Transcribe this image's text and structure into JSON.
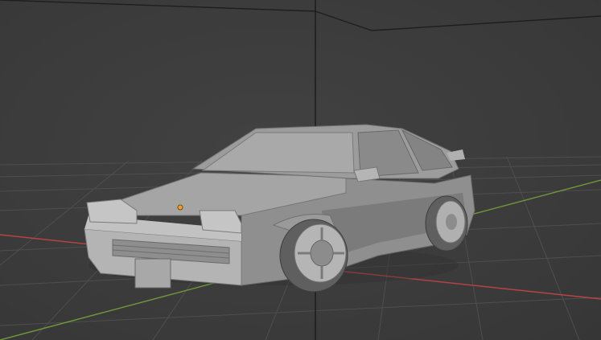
{
  "viewport": {
    "mode": "solid-shading",
    "background_color": "#3d3d3d",
    "grid_color": "#4f4f4f",
    "x_axis_color": "#b84444",
    "y_axis_color": "#6f9a3a",
    "z_axis_color": "#1a1a1a"
  },
  "scene": {
    "object": "car-mesh",
    "object_color": "#9a9a9a",
    "origin_color": "#f0a030"
  }
}
